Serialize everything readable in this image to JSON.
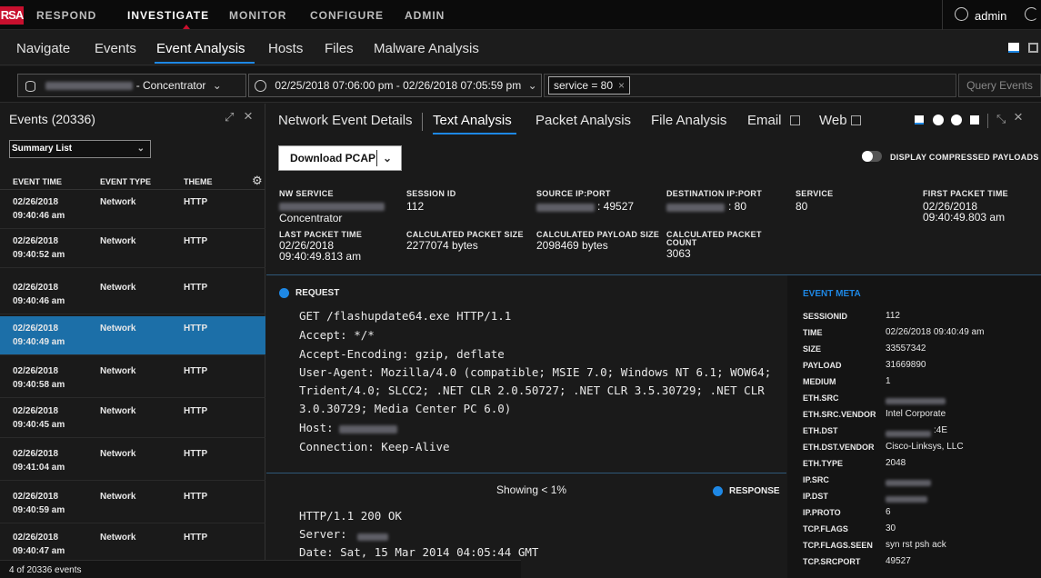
{
  "topbar": {
    "logo": "RSA",
    "nav": [
      "RESPOND",
      "INVESTIGATE",
      "MONITOR",
      "CONFIGURE",
      "ADMIN"
    ],
    "user": "admin"
  },
  "subnav": [
    "Navigate",
    "Events",
    "Event Analysis",
    "Hosts",
    "Files",
    "Malware Analysis"
  ],
  "query": {
    "service_suffix": "- Concentrator",
    "time_range": "02/25/2018 07:06:00 pm - 02/26/2018 07:05:59 pm",
    "filter": "service = 80",
    "query_button": "Query Events"
  },
  "events": {
    "title": "Events (20336)",
    "view": "Summary List",
    "headers": [
      "EVENT TIME",
      "EVENT TYPE",
      "THEME"
    ],
    "rows": [
      {
        "date": "02/26/2018",
        "time": "09:40:46 am",
        "type": "Network",
        "theme": "HTTP"
      },
      {
        "date": "02/26/2018",
        "time": "09:40:52 am",
        "type": "Network",
        "theme": "HTTP"
      },
      {
        "date": "02/26/2018",
        "time": "09:40:46 am",
        "type": "Network",
        "theme": "HTTP"
      },
      {
        "date": "02/26/2018",
        "time": "09:40:49 am",
        "type": "Network",
        "theme": "HTTP"
      },
      {
        "date": "02/26/2018",
        "time": "09:40:58 am",
        "type": "Network",
        "theme": "HTTP"
      },
      {
        "date": "02/26/2018",
        "time": "09:40:45 am",
        "type": "Network",
        "theme": "HTTP"
      },
      {
        "date": "02/26/2018",
        "time": "09:41:04 am",
        "type": "Network",
        "theme": "HTTP"
      },
      {
        "date": "02/26/2018",
        "time": "09:40:59 am",
        "type": "Network",
        "theme": "HTTP"
      },
      {
        "date": "02/26/2018",
        "time": "09:40:47 am",
        "type": "Network",
        "theme": "HTTP"
      }
    ],
    "footer": "4 of 20336 events"
  },
  "tabs": [
    "Network Event Details",
    "Text Analysis",
    "Packet Analysis",
    "File Analysis",
    "Email",
    "Web"
  ],
  "download": "Download PCAP",
  "compressed": "DISPLAY COMPRESSED PAYLOADS",
  "details": {
    "nw_service": {
      "label": "NW SERVICE",
      "value": "Concentrator"
    },
    "session_id": {
      "label": "SESSION ID",
      "value": "112"
    },
    "source": {
      "label": "SOURCE IP:PORT",
      "value": ": 49527"
    },
    "destination": {
      "label": "DESTINATION IP:PORT",
      "value": ": 80"
    },
    "service": {
      "label": "SERVICE",
      "value": "80"
    },
    "first_packet": {
      "label": "FIRST PACKET TIME",
      "date": "02/26/2018",
      "time": "09:40:49.803 am"
    },
    "last_packet": {
      "label": "LAST PACKET TIME",
      "date": "02/26/2018",
      "time": "09:40:49.813 am"
    },
    "calc_packet": {
      "label": "CALCULATED PACKET SIZE",
      "value": "2277074 bytes"
    },
    "calc_payload": {
      "label": "CALCULATED PAYLOAD SIZE",
      "value": "2098469 bytes"
    },
    "calc_count": {
      "label1": "CALCULATED PACKET",
      "label2": "COUNT",
      "value": "3063"
    }
  },
  "request": {
    "title": "REQUEST",
    "lines": [
      "GET /flashupdate64.exe HTTP/1.1",
      "Accept: */*",
      "Accept-Encoding: gzip, deflate",
      "User-Agent: Mozilla/4.0 (compatible; MSIE 7.0; Windows NT 6.1; WOW64;",
      "Trident/4.0; SLCC2; .NET CLR 2.0.50727; .NET CLR 3.5.30729; .NET CLR",
      "3.0.30729; Media Center PC 6.0)",
      "Host:",
      "Connection: Keep-Alive"
    ]
  },
  "showing": "Showing < 1%",
  "response": {
    "title": "RESPONSE",
    "lines": [
      "HTTP/1.1 200 OK",
      "Server:",
      "Date: Sat, 15 Mar 2014 04:05:44 GMT"
    ]
  },
  "meta": {
    "title": "EVENT META",
    "items": [
      {
        "k": "SESSIONID",
        "v": "112"
      },
      {
        "k": "TIME",
        "v": "02/26/2018 09:40:49 am"
      },
      {
        "k": "SIZE",
        "v": "33557342"
      },
      {
        "k": "PAYLOAD",
        "v": "31669890"
      },
      {
        "k": "MEDIUM",
        "v": "1"
      },
      {
        "k": "ETH.SRC",
        "v": ""
      },
      {
        "k": "ETH.SRC.VENDOR",
        "v": "Intel Corporate"
      },
      {
        "k": "ETH.DST",
        "v": ":4E"
      },
      {
        "k": "ETH.DST.VENDOR",
        "v": "Cisco-Linksys, LLC"
      },
      {
        "k": "ETH.TYPE",
        "v": "2048"
      },
      {
        "k": "IP.SRC",
        "v": ""
      },
      {
        "k": "IP.DST",
        "v": ""
      },
      {
        "k": "IP.PROTO",
        "v": "6"
      },
      {
        "k": "TCP.FLAGS",
        "v": "30"
      },
      {
        "k": "TCP.FLAGS.SEEN",
        "v": "syn rst psh ack"
      },
      {
        "k": "TCP.SRCPORT",
        "v": "49527"
      }
    ]
  },
  "colors": {
    "accent": "#1e88e5",
    "selected_row": "#1c6fa8",
    "brand": "#c8102e"
  }
}
